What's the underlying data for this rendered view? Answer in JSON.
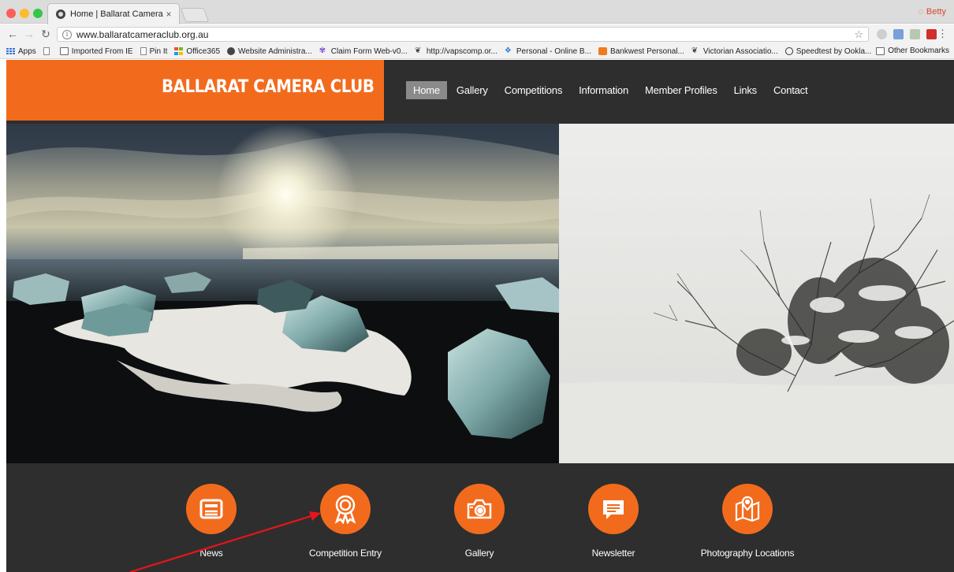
{
  "browser": {
    "tab_title": "Home | Ballarat Camera Club",
    "tab_close": "×",
    "profile_name": "Betty",
    "url": "www.ballaratcameraclub.org.au",
    "bookmarks": [
      {
        "label": "Apps",
        "icon": "apps-grid-icon"
      },
      {
        "label": "",
        "icon": "page-icon"
      },
      {
        "label": "Imported From IE",
        "icon": "folder-icon"
      },
      {
        "label": "Pin It",
        "icon": "page-icon"
      },
      {
        "label": "Office365",
        "icon": "office365-icon"
      },
      {
        "label": "Website Administra...",
        "icon": "club-icon"
      },
      {
        "label": "Claim Form Web-v0...",
        "icon": "tree-icon"
      },
      {
        "label": "http://vapscomp.or...",
        "icon": "vaps-icon"
      },
      {
        "label": "Personal - Online B...",
        "icon": "bank-icon"
      },
      {
        "label": "Bankwest Personal...",
        "icon": "bankwest-icon"
      },
      {
        "label": "Victorian Associatio...",
        "icon": "vaps-icon"
      },
      {
        "label": "Speedtest by Ookla...",
        "icon": "speedtest-icon"
      }
    ],
    "other_bookmarks": "Other Bookmarks"
  },
  "site": {
    "logo": "BALLARAT CAMERA CLUB",
    "nav": [
      "Home",
      "Gallery",
      "Competitions",
      "Information",
      "Member Profiles",
      "Links",
      "Contact"
    ],
    "active_nav": "Home",
    "quick_links": [
      {
        "label": "News",
        "icon": "newspaper-icon"
      },
      {
        "label": "Competition Entry",
        "icon": "award-ribbon-icon"
      },
      {
        "label": "Gallery",
        "icon": "camera-icon"
      },
      {
        "label": "Newsletter",
        "icon": "chat-bubble-icon"
      },
      {
        "label": "Photography Locations",
        "icon": "map-pin-icon"
      }
    ]
  },
  "colors": {
    "accent": "#f26b1d",
    "dark": "#2e2e2e",
    "active_nav": "#8a8a8a",
    "annotation_arrow": "#e8141a"
  }
}
